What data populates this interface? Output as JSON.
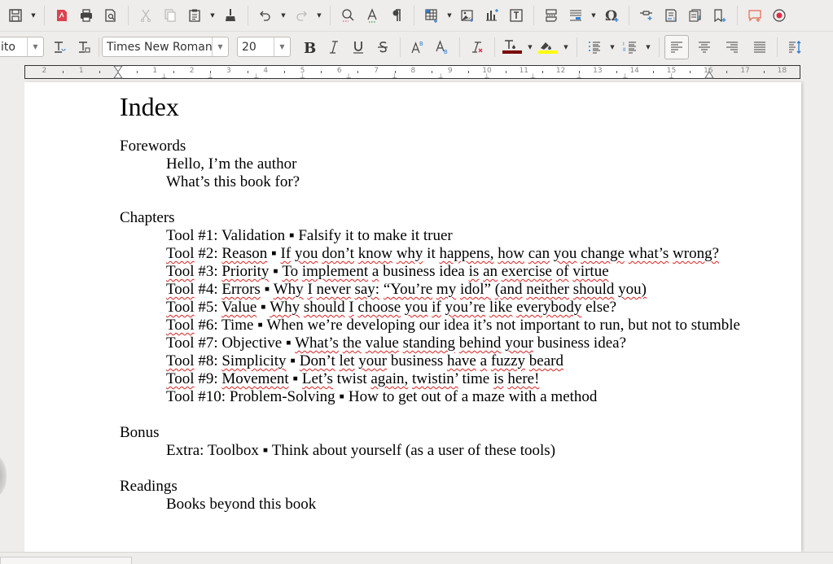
{
  "toolbar_standard": {
    "items": [
      {
        "name": "save-button",
        "icon": "save-icon"
      },
      {
        "name": "export-pdf-button",
        "icon": "pdf-icon"
      },
      {
        "name": "print-button",
        "icon": "printer-icon"
      },
      {
        "name": "print-preview-button",
        "icon": "print-preview-icon"
      },
      {
        "name": "cut-button",
        "icon": "scissors-icon",
        "disabled": true
      },
      {
        "name": "copy-button",
        "icon": "copy-icon",
        "disabled": true
      },
      {
        "name": "paste-button",
        "icon": "clipboard-icon"
      },
      {
        "name": "clone-formatting-button",
        "icon": "paintbrush-icon"
      },
      {
        "name": "undo-button",
        "icon": "undo-icon"
      },
      {
        "name": "redo-button",
        "icon": "redo-icon",
        "disabled": true
      },
      {
        "name": "find-replace-button",
        "icon": "search-icon"
      },
      {
        "name": "spelling-button",
        "icon": "spellcheck-icon"
      },
      {
        "name": "formatting-marks-button",
        "icon": "pilcrow-icon"
      },
      {
        "name": "insert-table-button",
        "icon": "table-icon"
      },
      {
        "name": "insert-image-button",
        "icon": "image-icon"
      },
      {
        "name": "insert-chart-button",
        "icon": "chart-icon"
      },
      {
        "name": "insert-textbox-button",
        "icon": "textbox-icon"
      },
      {
        "name": "insert-page-break-button",
        "icon": "page-break-icon"
      },
      {
        "name": "insert-field-button",
        "icon": "field-icon"
      },
      {
        "name": "insert-special-char-button",
        "icon": "omega-icon"
      },
      {
        "name": "insert-hyperlink-button",
        "icon": "link-icon"
      },
      {
        "name": "insert-footnote-button",
        "icon": "footnote-icon"
      },
      {
        "name": "insert-endnote-button",
        "icon": "endnote-icon"
      },
      {
        "name": "insert-bookmark-button",
        "icon": "bookmark-icon"
      },
      {
        "name": "insert-comment-button",
        "icon": "comment-icon"
      },
      {
        "name": "track-changes-button",
        "icon": "record-icon"
      }
    ]
  },
  "toolbar_formatting": {
    "paragraph_style": "ito",
    "font_name": "Times New Roman",
    "font_size": "20",
    "text_color": "#7a0000",
    "highlight_color": "#ffff00",
    "active_alignment": "left"
  },
  "ruler": {
    "left_labels": [
      "2",
      "1"
    ],
    "labels": [
      "1",
      "2",
      "3",
      "4",
      "5",
      "6",
      "7",
      "8",
      "9",
      "10",
      "11",
      "12",
      "13",
      "14",
      "15",
      "16",
      "17",
      "18"
    ]
  },
  "document": {
    "title": "Index",
    "sections": [
      {
        "title": "Forewords",
        "entries": [
          "Hello, I’m the author",
          "What’s this book for?"
        ]
      },
      {
        "title": "Chapters",
        "entries": [
          "Tool #1: Validation ▪ Falsify it to make it truer",
          "Tool #2: Reason ▪ If you don’t know why it happens, how can you change what’s wrong?",
          "Tool #3: Priority ▪ To implement a business idea is an exercise of virtue",
          "Tool #4: Errors ▪ Why I never say: “You’re my idol” (and neither should you)",
          "Tool #5: Value ▪ Why should I choose you if you’re like everybody else?",
          "Tool #6: Time ▪ When we’re developing our idea it’s not important to run, but not to stumble",
          "Tool #7: Objective ▪ What’s the value standing behind your business idea?",
          "Tool #8: Simplicity ▪ Don’t let your business have a fuzzy beard",
          "Tool #9: Movement ▪ Let’s twist again, twistin’ time is here!",
          "Tool #10: Problem-Solving ▪ How to get out of a maze with a method"
        ]
      },
      {
        "title": "Bonus",
        "entries": [
          "Extra: Toolbox ▪ Think about yourself (as a user of these tools)"
        ]
      },
      {
        "title": "Readings",
        "entries": [
          "Books beyond this book"
        ]
      }
    ]
  }
}
